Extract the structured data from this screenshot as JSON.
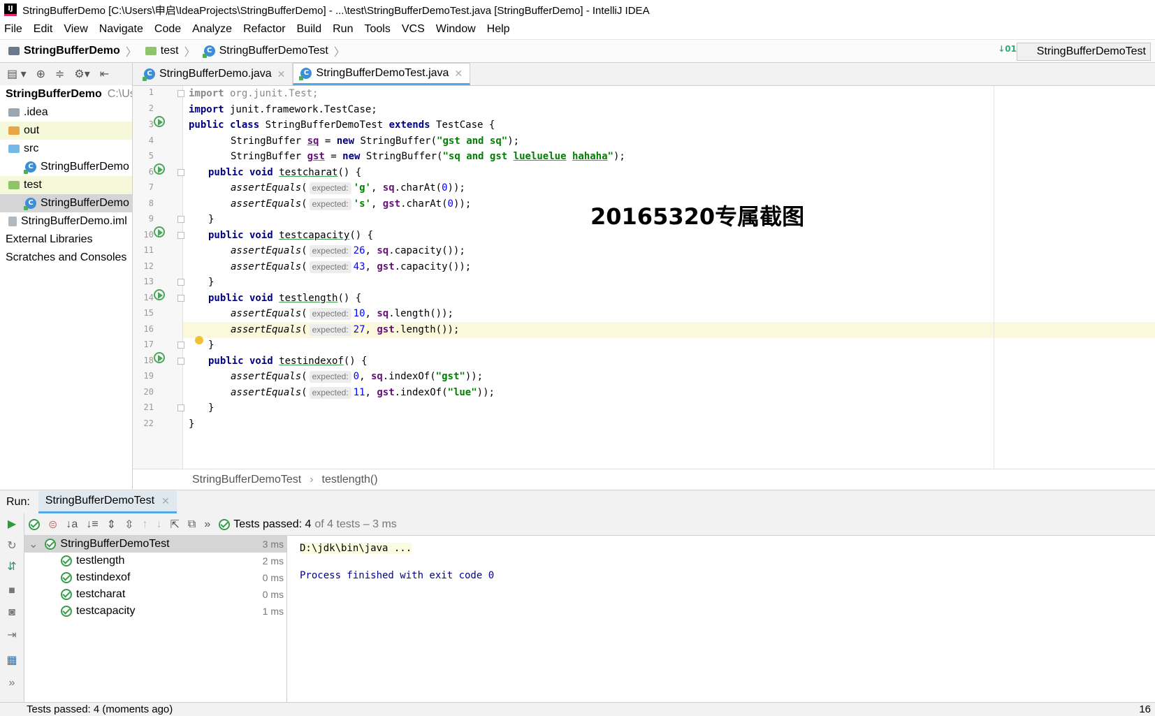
{
  "window": {
    "title": "StringBufferDemo [C:\\Users\\申启\\IdeaProjects\\StringBufferDemo] - ...\\test\\StringBufferDemoTest.java [StringBufferDemo] - IntelliJ IDEA",
    "logo_text": "IJ"
  },
  "menu": [
    "File",
    "Edit",
    "View",
    "Navigate",
    "Code",
    "Analyze",
    "Refactor",
    "Build",
    "Run",
    "Tools",
    "VCS",
    "Window",
    "Help"
  ],
  "breadcrumb": [
    "StringBufferDemo",
    "test",
    "StringBufferDemoTest"
  ],
  "run_config": "StringBufferDemoTest",
  "project_tree": [
    {
      "label": "StringBufferDemo",
      "path": "C:\\Us",
      "indent": 0,
      "icon": "module-folder-icon"
    },
    {
      "label": ".idea",
      "indent": 1,
      "icon": "folder-icon"
    },
    {
      "label": "out",
      "indent": 1,
      "icon": "excluded-folder-icon"
    },
    {
      "label": "src",
      "indent": 1,
      "icon": "source-folder-icon"
    },
    {
      "label": "StringBufferDemo",
      "indent": 2,
      "icon": "java-class-icon"
    },
    {
      "label": "test",
      "indent": 1,
      "icon": "test-folder-icon"
    },
    {
      "label": "StringBufferDemo",
      "indent": 2,
      "icon": "java-class-icon"
    },
    {
      "label": "StringBufferDemo.iml",
      "indent": 1,
      "icon": "iml-file-icon"
    },
    {
      "label": "External Libraries",
      "indent": 0,
      "icon": "libraries-icon"
    },
    {
      "label": "Scratches and Consoles",
      "indent": 0,
      "icon": "scratches-icon"
    }
  ],
  "tabs": [
    {
      "label": "StringBufferDemo.java",
      "active": false
    },
    {
      "label": "StringBufferDemoTest.java",
      "active": true
    }
  ],
  "code": {
    "line_numbers": [
      "1",
      "2",
      "3",
      "4",
      "5",
      "6",
      "7",
      "8",
      "9",
      "10",
      "11",
      "12",
      "13",
      "14",
      "15",
      "16",
      "17",
      "18",
      "19",
      "20",
      "21",
      "22"
    ],
    "hint_label": "expected:",
    "l1": [
      "import",
      " org.junit.Test;"
    ],
    "l2": [
      "import",
      " junit.framework.TestCase;"
    ],
    "l3": [
      "public class",
      " StringBufferDemoTest ",
      "extends",
      " TestCase {"
    ],
    "l4": [
      "StringBuffer ",
      "sq",
      " = ",
      "new",
      " StringBuffer(",
      "\"gst and sq\"",
      ");"
    ],
    "l5": [
      "StringBuffer ",
      "gst",
      " = ",
      "new",
      " StringBuffer(",
      "\"sq and gst ",
      "lueluelue",
      " ",
      "hahaha",
      "\"",
      ");"
    ],
    "l6": [
      "public void",
      " ",
      "testcharat",
      "() {"
    ],
    "l7": [
      "assertEquals",
      "(",
      "'g'",
      ", ",
      "sq",
      ".charAt(",
      "0",
      "));"
    ],
    "l8": [
      "assertEquals",
      "(",
      "'s'",
      ", ",
      "gst",
      ".charAt(",
      "0",
      "));"
    ],
    "l9": "}",
    "l10": [
      "public void",
      " ",
      "testcapacity",
      "() {"
    ],
    "l11": [
      "assertEquals",
      "(",
      "26",
      ", ",
      "sq",
      ".capacity());"
    ],
    "l12": [
      "assertEquals",
      "(",
      "43",
      ", ",
      "gst",
      ".capacity());"
    ],
    "l13": "}",
    "l14": [
      "public void",
      " ",
      "testlength",
      "() {"
    ],
    "l15": [
      "assertEquals",
      "(",
      "10",
      ", ",
      "sq",
      ".length());"
    ],
    "l16": [
      "assertEquals",
      "(",
      "27",
      ", ",
      "gst",
      ".length());"
    ],
    "l17": "}",
    "l18": [
      "public void",
      " ",
      "testindexof",
      "() {"
    ],
    "l19": [
      "assertEquals",
      "(",
      "0",
      ", ",
      "sq",
      ".indexOf(",
      "\"gst\"",
      "));"
    ],
    "l20": [
      "assertEquals",
      "(",
      "11",
      ", ",
      "gst",
      ".indexOf(",
      "\"lue\"",
      "));"
    ],
    "l21": "}",
    "l22": "}"
  },
  "watermark": "20165320专属截图",
  "editor_breadcrumb": [
    "StringBufferDemoTest",
    "testlength()"
  ],
  "run_panel": {
    "label": "Run:",
    "tab": "StringBufferDemoTest",
    "summary_bold": "Tests passed: 4",
    "summary_rest": "of 4 tests – 3 ms",
    "more": "»",
    "tests": [
      {
        "name": "StringBufferDemoTest",
        "time": "3 ms",
        "root": true
      },
      {
        "name": "testlength",
        "time": "2 ms"
      },
      {
        "name": "testindexof",
        "time": "0 ms"
      },
      {
        "name": "testcharat",
        "time": "0 ms"
      },
      {
        "name": "testcapacity",
        "time": "1 ms"
      }
    ],
    "console": [
      "D:\\jdk\\bin\\java ...",
      "",
      "Process finished with exit code 0"
    ]
  },
  "status": {
    "left": "Tests passed: 4 (moments ago)",
    "right": "16"
  },
  "colors": {
    "accent": "#53a7e6",
    "pass": "#3b9b4b",
    "keyword": "#000080",
    "string": "#008000",
    "field": "#660e7a",
    "number": "#0000ff"
  }
}
